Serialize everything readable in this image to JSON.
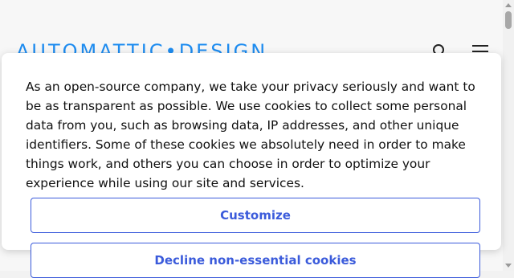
{
  "header": {
    "logo_text": "AUTOMATTIC•DESIGN",
    "search_icon": "search-icon",
    "menu_icon": "menu-icon"
  },
  "cookie_banner": {
    "text": "As an open-source company, we take your privacy seriously and want to be as transparent as possible. We use cookies to collect some personal data from you, such as browsing data, IP addresses, and other unique identifiers. Some of these cookies we absolutely need in order to make things work, and others you can choose in order to optimize your experience while using our site and services.",
    "customize_label": "Customize",
    "decline_label": "Decline non-essential cookies"
  },
  "colors": {
    "logo": "#1e8cf0",
    "button_accent": "#3b5bdb"
  }
}
